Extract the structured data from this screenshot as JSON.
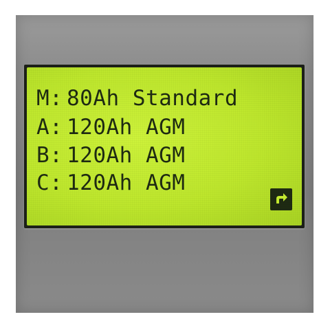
{
  "display": {
    "rows": [
      {
        "slot": "M:",
        "battery": "80Ah Standard"
      },
      {
        "slot": "A:",
        "battery": "120Ah AGM"
      },
      {
        "slot": "B:",
        "battery": "120Ah AGM"
      },
      {
        "slot": "C:",
        "battery": "120Ah AGM"
      }
    ],
    "next_icon": "return-arrow-icon"
  },
  "colors": {
    "lcd_background": "#c5ec30",
    "lcd_text": "#1e2a12",
    "housing": "#8d8d8d"
  }
}
